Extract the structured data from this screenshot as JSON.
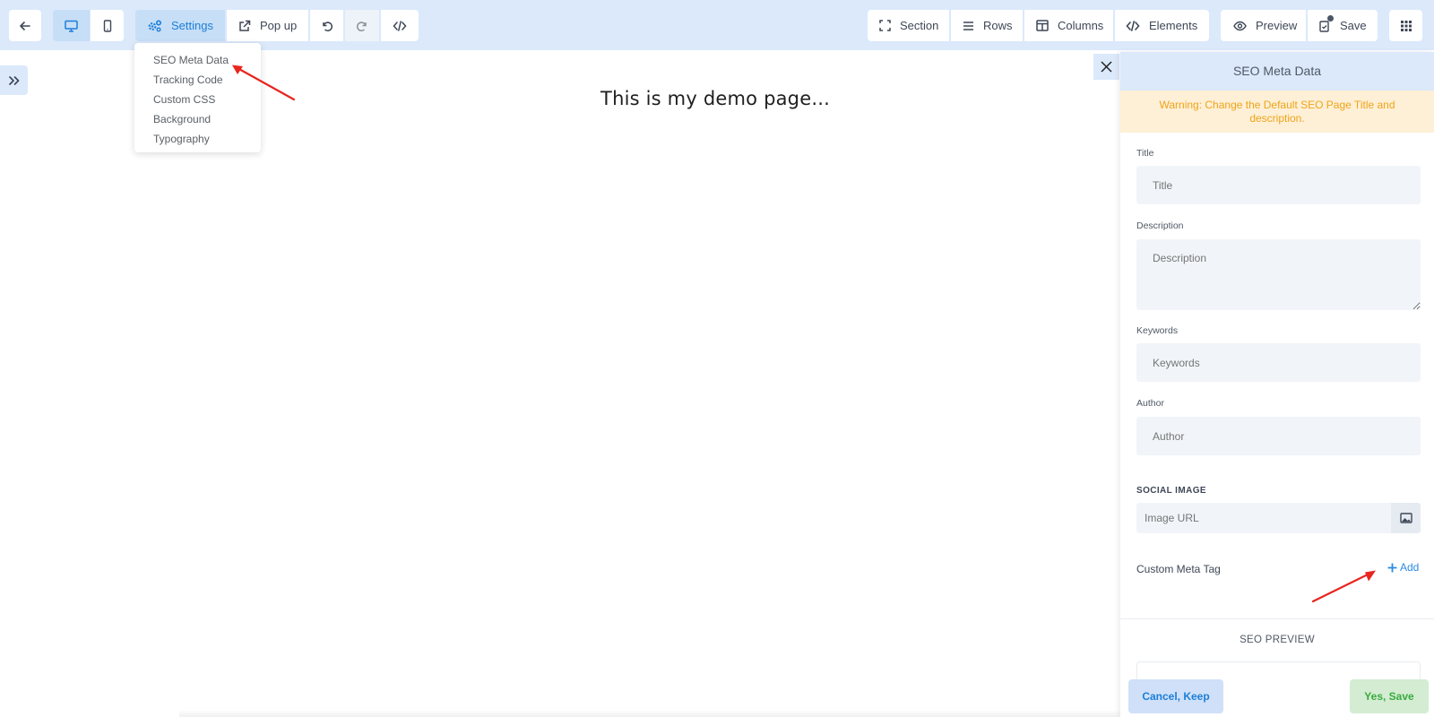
{
  "toolbar": {
    "back_icon": "arrow-left-icon",
    "desktop_icon": "desktop-icon",
    "mobile_icon": "mobile-icon",
    "settings_label": "Settings",
    "popup_label": "Pop up",
    "undo_icon": "undo-icon",
    "redo_icon": "redo-icon",
    "code_icon": "code-icon",
    "section_label": "Section",
    "rows_label": "Rows",
    "columns_label": "Columns",
    "elements_label": "Elements",
    "preview_label": "Preview",
    "save_label": "Save",
    "apps_icon": "grid-icon"
  },
  "settings_menu": {
    "items": [
      "SEO Meta Data",
      "Tracking Code",
      "Custom CSS",
      "Background",
      "Typography"
    ]
  },
  "canvas": {
    "text": "This is my demo page..."
  },
  "panel": {
    "title": "SEO Meta Data",
    "warning": "Warning: Change the Default SEO Page Title and description.",
    "fields": {
      "title_label": "Title",
      "title_placeholder": "Title",
      "description_label": "Description",
      "description_placeholder": "Description",
      "keywords_label": "Keywords",
      "keywords_placeholder": "Keywords",
      "author_label": "Author",
      "author_placeholder": "Author"
    },
    "social_image_label": "SOCIAL IMAGE",
    "image_url_placeholder": "Image URL",
    "custom_meta_label": "Custom Meta Tag",
    "add_label": "Add",
    "seo_preview_label": "SEO PREVIEW",
    "cancel_label": "Cancel, Keep",
    "yes_label": "Yes, Save"
  },
  "colors": {
    "accent": "#1c7fd8",
    "toolbar_bg": "#dbe9fb",
    "warning_bg": "#fdf0d6",
    "warning_text": "#f0a31a",
    "annotation_arrow": "#e8251f",
    "save_green": "#3aab3f"
  }
}
